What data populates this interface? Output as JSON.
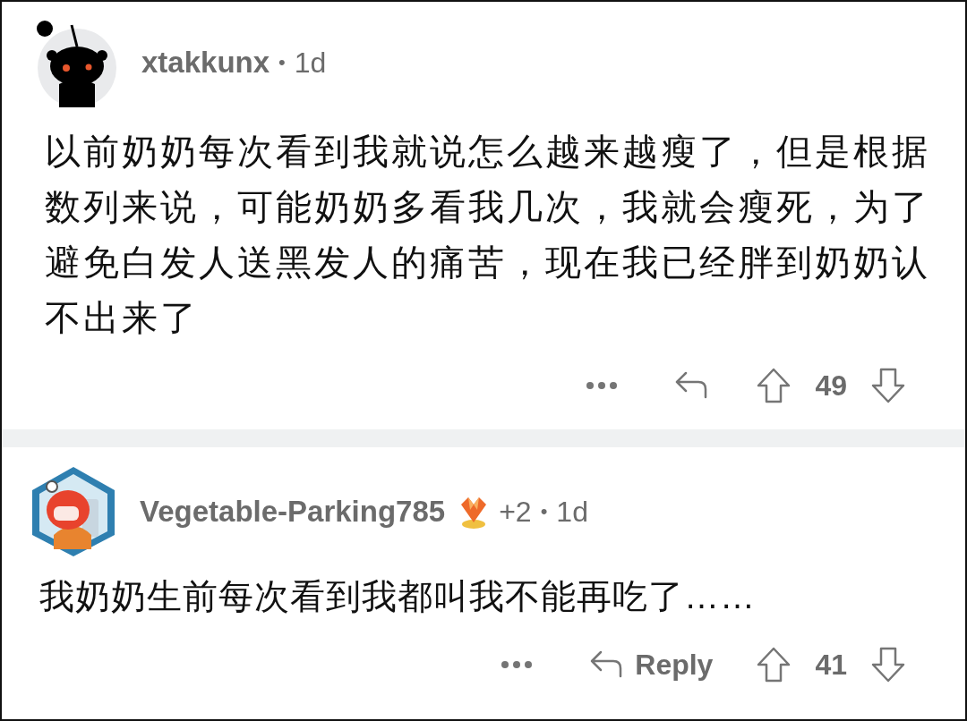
{
  "comments": [
    {
      "avatar": {
        "kind": "default"
      },
      "username": "xtakkunx",
      "separator": "•",
      "time": "1d",
      "body": "以前奶奶每次看到我就说怎么越来越瘦了，但是根据数列来说，可能奶奶多看我几次，我就会瘦死，为了避免白发人送黑发人的痛苦，现在我已经胖到奶奶认不出来了",
      "score": "49"
    },
    {
      "avatar": {
        "kind": "custom"
      },
      "username": "Vegetable-Parking785",
      "award_count": "+2",
      "separator": "•",
      "time": "1d",
      "body": "我奶奶生前每次看到我都叫我不能再吃了……",
      "reply_label": "Reply",
      "score": "41"
    }
  ]
}
